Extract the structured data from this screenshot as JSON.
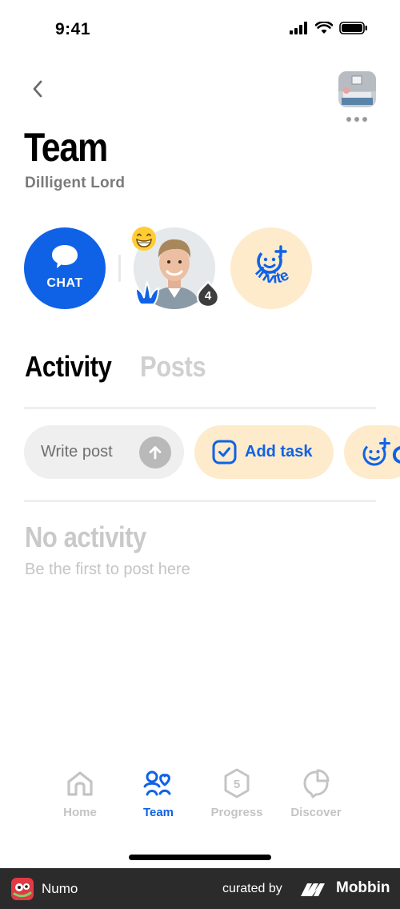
{
  "status_bar": {
    "time": "9:41",
    "icons": [
      "signal-icon",
      "wifi-icon",
      "battery-icon"
    ]
  },
  "header": {
    "title": "Team",
    "subtitle": "Dilligent Lord"
  },
  "actions": {
    "chat_label": "CHAT",
    "invite_label": "Invite",
    "member_badge_count": "4"
  },
  "tabs": [
    {
      "label": "Activity",
      "active": true
    },
    {
      "label": "Posts",
      "active": false
    }
  ],
  "quick_actions": {
    "write_post_placeholder": "Write post",
    "add_task_label": "Add task"
  },
  "empty_state": {
    "title": "No activity",
    "subtitle": "Be the first to post here"
  },
  "tab_bar": [
    {
      "label": "Home",
      "icon": "home-icon",
      "active": false
    },
    {
      "label": "Team",
      "icon": "team-icon",
      "active": true
    },
    {
      "label": "Progress",
      "icon": "progress-icon",
      "badge": "5",
      "active": false
    },
    {
      "label": "Discover",
      "icon": "discover-icon",
      "active": false
    }
  ],
  "footer": {
    "app_name": "Numo",
    "curated_by": "curated by",
    "brand": "Mobbin"
  },
  "colors": {
    "accent": "#0f62e6",
    "peach": "#fdebcc",
    "muted": "#c4c4c4"
  }
}
